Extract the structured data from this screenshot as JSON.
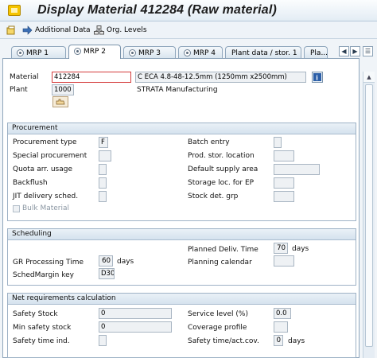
{
  "window": {
    "title": "Display Material 412284 (Raw material)"
  },
  "toolbar": {
    "additional_data": "Additional Data",
    "org_levels": "Org. Levels"
  },
  "tabs": [
    "MRP 1",
    "MRP 2",
    "MRP 3",
    "MRP 4",
    "Plant data / stor. 1",
    "Pla..."
  ],
  "header": {
    "material_label": "Material",
    "material_value": "412284",
    "material_desc": "C ECA 4.8-48-12.5mm (1250mm x2500mm)",
    "plant_label": "Plant",
    "plant_value": "1000",
    "plant_desc": "STRATA Manufacturing"
  },
  "procurement": {
    "title": "Procurement",
    "procurement_type_label": "Procurement type",
    "procurement_type_value": "F",
    "special_procurement_label": "Special procurement",
    "quota_label": "Quota arr. usage",
    "backflush_label": "Backflush",
    "jit_label": "JIT delivery sched.",
    "bulk_label": "Bulk Material",
    "batch_entry_label": "Batch entry",
    "prod_stor_label": "Prod. stor. location",
    "default_supply_label": "Default supply area",
    "storage_ep_label": "Storage loc. for EP",
    "stock_det_label": "Stock det. grp"
  },
  "scheduling": {
    "title": "Scheduling",
    "planned_deliv_label": "Planned Deliv. Time",
    "planned_deliv_value": "70",
    "planned_deliv_unit": "days",
    "gr_label": "GR Processing Time",
    "gr_value": "60",
    "gr_unit": "days",
    "planning_cal_label": "Planning calendar",
    "schedmargin_label": "SchedMargin key",
    "schedmargin_value": "D30"
  },
  "net_requirements": {
    "title": "Net requirements calculation",
    "safety_stock_label": "Safety Stock",
    "safety_stock_value": "0",
    "service_level_label": "Service level (%)",
    "service_level_value": "0.0",
    "min_safety_label": "Min safety stock",
    "min_safety_value": "0",
    "coverage_label": "Coverage profile",
    "safety_time_ind_label": "Safety time ind.",
    "safety_time_act_label": "Safety time/act.cov.",
    "safety_time_act_value": "0",
    "safety_time_act_unit": "days"
  }
}
